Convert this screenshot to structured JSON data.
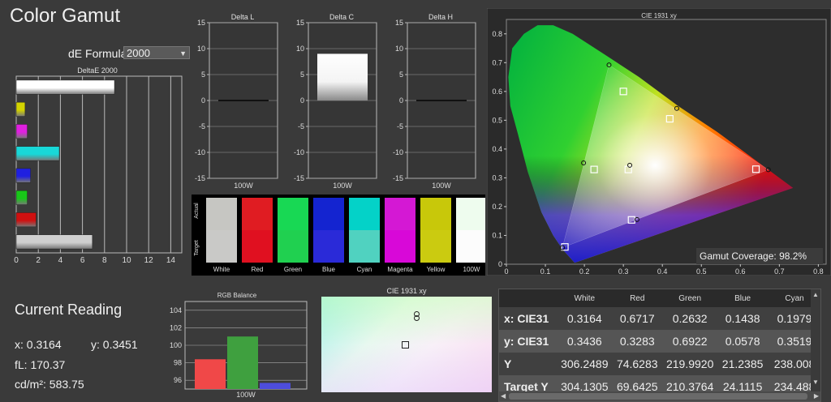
{
  "app_title": "Color Gamut",
  "formula": {
    "label": "dE Formula:",
    "value": "2000"
  },
  "deltae_chart": {
    "title": "DeltaE 2000",
    "xlim": [
      0,
      15
    ],
    "ticks": [
      "0",
      "2",
      "4",
      "6",
      "8",
      "10",
      "12",
      "14"
    ],
    "bars": [
      {
        "name": "White",
        "value": 8.9,
        "color": "#ffffff"
      },
      {
        "name": "Yellow",
        "value": 0.8,
        "color": "#d4d400"
      },
      {
        "name": "Magenta",
        "value": 1.0,
        "color": "#e020e0"
      },
      {
        "name": "Cyan",
        "value": 3.9,
        "color": "#18d8d8"
      },
      {
        "name": "Blue",
        "value": 1.3,
        "color": "#2020e0"
      },
      {
        "name": "Green",
        "value": 1.0,
        "color": "#18c818"
      },
      {
        "name": "Red",
        "value": 1.8,
        "color": "#d01010"
      },
      {
        "name": "Gray",
        "value": 6.9,
        "color": "#cfcfcf"
      }
    ]
  },
  "delta_charts": [
    {
      "title": "Delta L",
      "xlabel": "100W",
      "value": 0.0,
      "ylim": [
        -15,
        15
      ],
      "ticks": [
        "15",
        "10",
        "5",
        "0",
        "-5",
        "-10",
        "-15"
      ]
    },
    {
      "title": "Delta C",
      "xlabel": "100W",
      "value": 9.0,
      "ylim": [
        -15,
        15
      ],
      "ticks": [
        "15",
        "10",
        "5",
        "0",
        "-5",
        "-10",
        "-15"
      ]
    },
    {
      "title": "Delta H",
      "xlabel": "100W",
      "value": 0.0,
      "ylim": [
        -15,
        15
      ],
      "ticks": [
        "15",
        "10",
        "5",
        "0",
        "-5",
        "-10",
        "-15"
      ]
    }
  ],
  "swatches": {
    "actual_label": "Actual",
    "target_label": "Target",
    "items": [
      {
        "name": "White",
        "actual": "#c6c6c2",
        "target": "#c9c9c7"
      },
      {
        "name": "Red",
        "actual": "#e01c22",
        "target": "#e01020"
      },
      {
        "name": "Green",
        "actual": "#18d854",
        "target": "#20d050"
      },
      {
        "name": "Blue",
        "actual": "#1424d0",
        "target": "#2a2ad8"
      },
      {
        "name": "Cyan",
        "actual": "#04d2c8",
        "target": "#50d2c0"
      },
      {
        "name": "Magenta",
        "actual": "#d418d4",
        "target": "#d808d8"
      },
      {
        "name": "Yellow",
        "actual": "#c8c80a",
        "target": "#cbcb10"
      },
      {
        "name": "100W",
        "actual": "#eefcee",
        "target": "#fcfcfc"
      }
    ]
  },
  "cie_chart": {
    "title": "CIE 1931 xy",
    "xticks": [
      "0",
      "0.1",
      "0.2",
      "0.3",
      "0.4",
      "0.5",
      "0.6",
      "0.7",
      "0.8"
    ],
    "yticks": [
      "0.8",
      "0.7",
      "0.6",
      "0.5",
      "0.4",
      "0.3",
      "0.2",
      "0.1",
      "0"
    ],
    "gamut_label": "Gamut Coverage:",
    "gamut_value": "98.2%",
    "targets": [
      {
        "name": "Red",
        "x": 0.64,
        "y": 0.33
      },
      {
        "name": "Green",
        "x": 0.3,
        "y": 0.6
      },
      {
        "name": "Blue",
        "x": 0.15,
        "y": 0.06
      },
      {
        "name": "White",
        "x": 0.3127,
        "y": 0.329
      },
      {
        "name": "Cyan",
        "x": 0.225,
        "y": 0.329
      },
      {
        "name": "Magenta",
        "x": 0.321,
        "y": 0.154
      },
      {
        "name": "Yellow",
        "x": 0.419,
        "y": 0.505
      }
    ],
    "measured": [
      {
        "name": "Red",
        "x": 0.6717,
        "y": 0.3283
      },
      {
        "name": "Green",
        "x": 0.2632,
        "y": 0.6922
      },
      {
        "name": "Blue",
        "x": 0.1438,
        "y": 0.0578
      },
      {
        "name": "White",
        "x": 0.3164,
        "y": 0.3436
      },
      {
        "name": "Cyan",
        "x": 0.1979,
        "y": 0.3519
      },
      {
        "name": "Magenta",
        "x": 0.335,
        "y": 0.155
      },
      {
        "name": "Yellow",
        "x": 0.437,
        "y": 0.541
      }
    ]
  },
  "rgb_balance": {
    "title": "RGB Balance",
    "xlabel": "100W",
    "ylim": [
      95,
      105
    ],
    "ticks": [
      "104",
      "102",
      "100",
      "98",
      "96"
    ],
    "bars": [
      {
        "name": "Red",
        "value": 98.4,
        "color": "#f04848"
      },
      {
        "name": "Green",
        "value": 101.0,
        "color": "#3fa03f"
      },
      {
        "name": "Blue",
        "value": 95.7,
        "color": "#4d4ddc"
      }
    ]
  },
  "small_cie": {
    "title": "CIE 1931 xy"
  },
  "current": {
    "title": "Current Reading",
    "x_label": "x: 0.3164",
    "y_label": "y: 0.3451",
    "fl_label": "fL: 170.37",
    "cdm2_label": "cd/m²: 583.75"
  },
  "table": {
    "columns": [
      "",
      "White",
      "Red",
      "Green",
      "Blue",
      "Cyan"
    ],
    "rows": [
      {
        "label": "x: CIE31",
        "values": [
          "0.3164",
          "0.6717",
          "0.2632",
          "0.1438",
          "0.1979"
        ]
      },
      {
        "label": "y: CIE31",
        "values": [
          "0.3436",
          "0.3283",
          "0.6922",
          "0.0578",
          "0.3519"
        ]
      },
      {
        "label": "Y",
        "values": [
          "306.2489",
          "74.6283",
          "219.9920",
          "21.2385",
          "238.008"
        ]
      },
      {
        "label": "Target Y",
        "values": [
          "304.1305",
          "69.6425",
          "210.3764",
          "24.1115",
          "234.488"
        ]
      }
    ]
  }
}
